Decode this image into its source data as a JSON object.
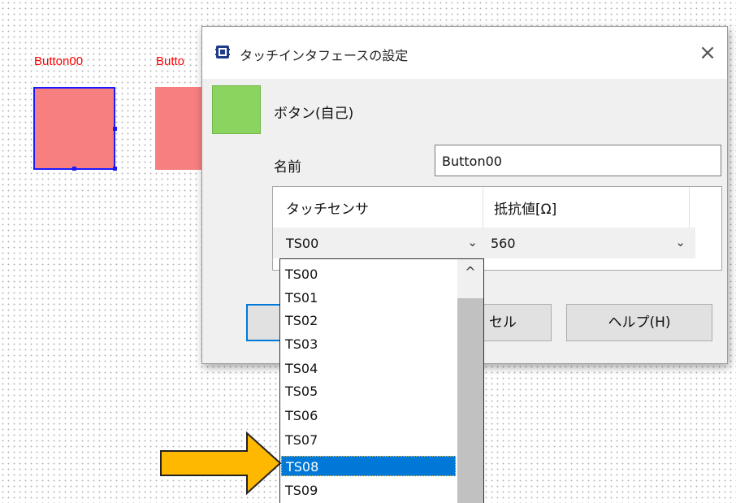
{
  "canvas": {
    "button1_label": "Button00",
    "button2_label": "Butto"
  },
  "dialog": {
    "title": "タッチインタフェースの設定",
    "type_label": "ボタン(自己)",
    "name_label": "名前",
    "name_value": "Button00",
    "grid": {
      "headers": [
        "タッチセンサ",
        "抵抗値[Ω]"
      ],
      "sensor_value": "TS00",
      "resistance_value": "560"
    },
    "buttons": {
      "ok": "",
      "cancel": "セル",
      "help": "ヘルプ(H)"
    }
  },
  "dropdown": {
    "items": [
      "TS00",
      "TS01",
      "TS02",
      "TS03",
      "TS04",
      "TS05",
      "TS06",
      "TS07",
      "TS08",
      "TS09"
    ],
    "selected": "TS08"
  },
  "colors": {
    "swatch": "#8ad45f",
    "canvas_button": "#f77f7f",
    "selection_blue": "#0078d7",
    "arrow": "#ffb800"
  },
  "icons": {
    "close": "×",
    "chevron_down": "⌄",
    "scroll_up": "^"
  }
}
